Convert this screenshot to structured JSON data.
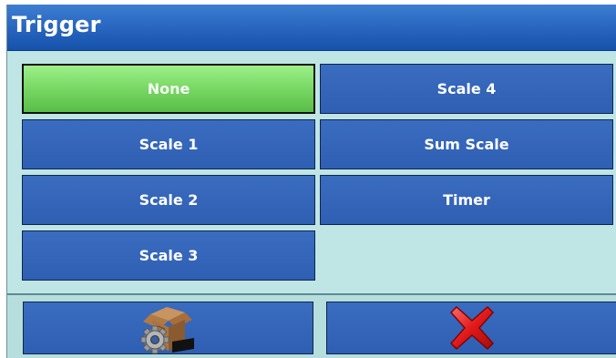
{
  "title": "Trigger",
  "options": [
    {
      "label": "None",
      "selected": true
    },
    {
      "label": "Scale 1",
      "selected": false
    },
    {
      "label": "Scale 2",
      "selected": false
    },
    {
      "label": "Scale 3",
      "selected": false
    },
    {
      "label": "Scale 4",
      "selected": false
    },
    {
      "label": "Sum Scale",
      "selected": false
    },
    {
      "label": "Timer",
      "selected": false
    }
  ],
  "actions": {
    "settings_icon": "box-gear-icon",
    "cancel_icon": "red-x-icon"
  },
  "colors": {
    "title_bar": "#2a68c2",
    "background": "#bfe6e4",
    "button": "#3366b8",
    "selected": "#7fdc6a",
    "cancel": "#e01818"
  }
}
